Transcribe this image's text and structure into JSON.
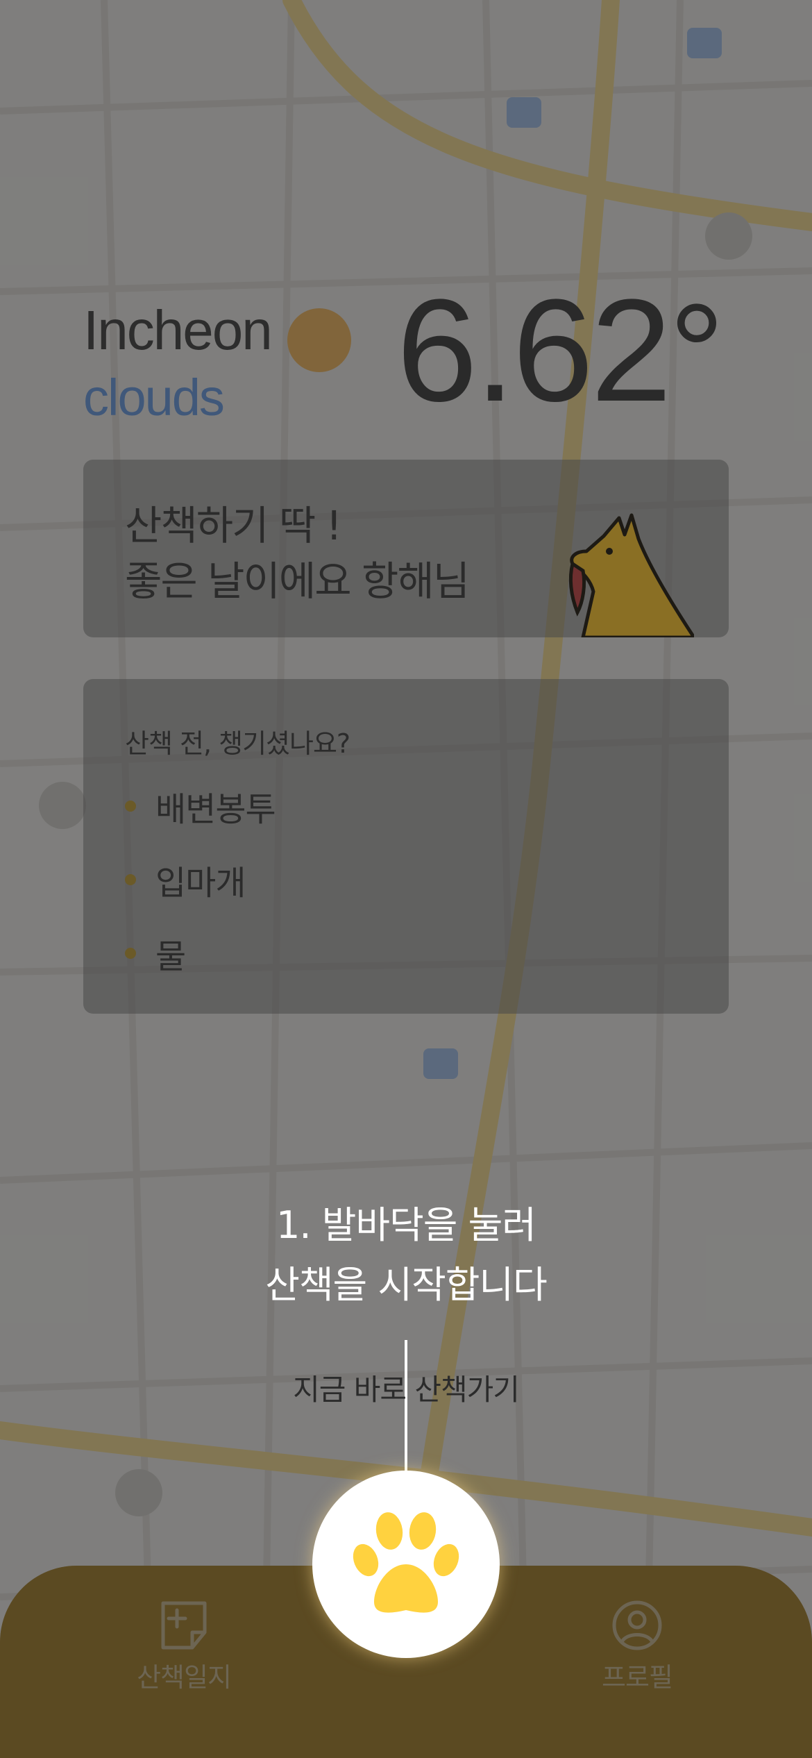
{
  "weather": {
    "city": "Incheon",
    "condition": "clouds",
    "temperature": "6.62",
    "degree_symbol": "°"
  },
  "greeting": {
    "line1": "산책하기 딱 !",
    "line2": "좋은 날이에요 항해님"
  },
  "checklist": {
    "title": "산책 전, 챙기셨나요?",
    "items": [
      {
        "label": "배변봉투"
      },
      {
        "label": "입마개"
      },
      {
        "label": "물"
      }
    ]
  },
  "coachmark": {
    "line1": "1. 발바닥을 눌러",
    "line2": "산책을 시작합니다",
    "cta": "지금 바로 산책가기"
  },
  "nav": {
    "left_label": "산책일지",
    "right_label": "프로필",
    "center_icon": "paw-icon",
    "left_icon": "note-add-icon",
    "right_icon": "profile-icon"
  },
  "colors": {
    "brand": "#5b4a22",
    "paw": "#ffd23f",
    "condition_text": "#40587a"
  }
}
